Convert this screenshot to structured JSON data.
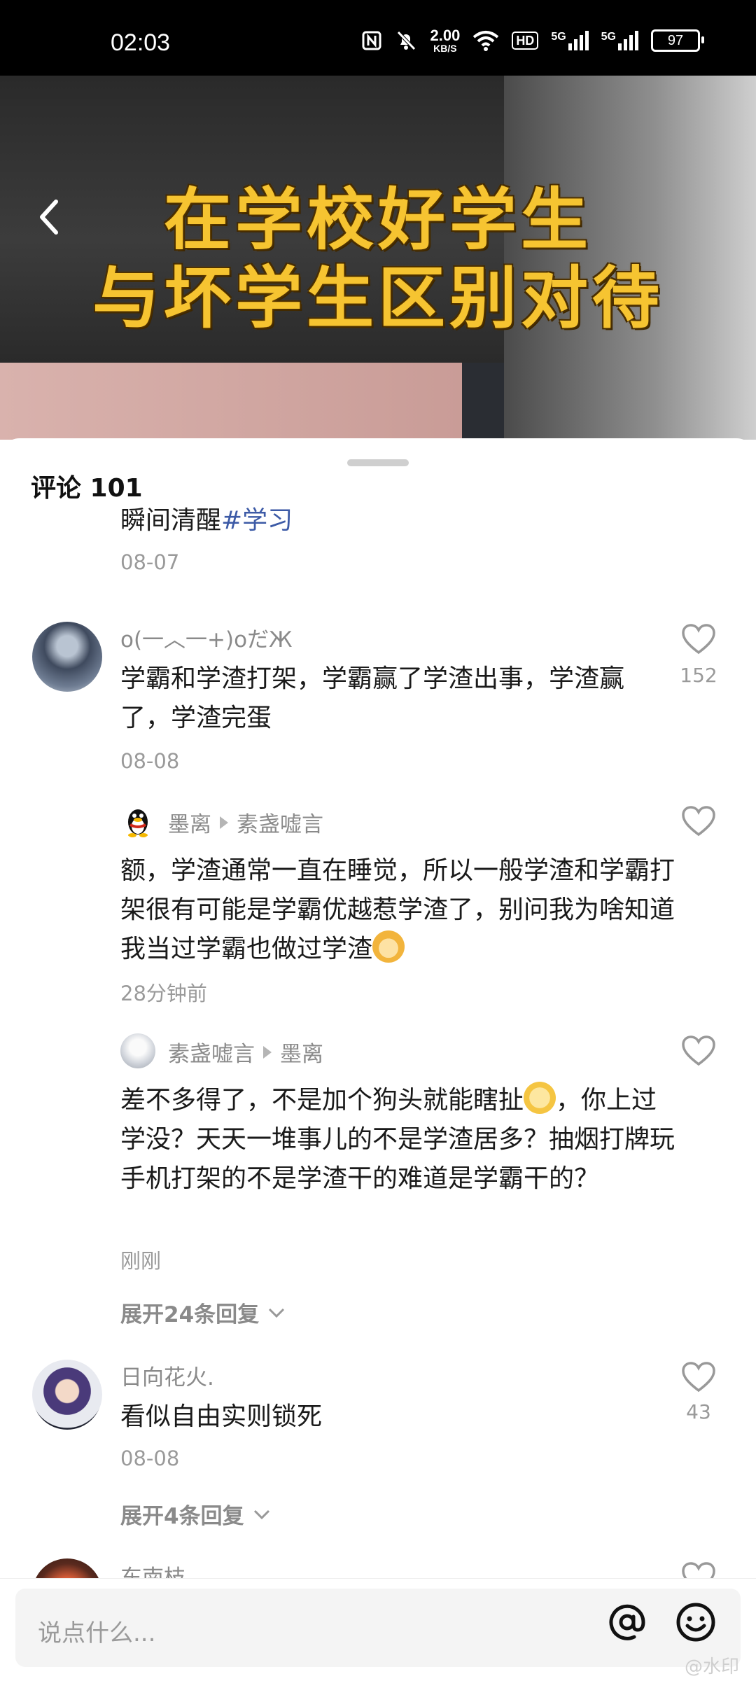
{
  "status_bar": {
    "time": "02:03",
    "net_speed": "2.00",
    "net_unit": "KB/S",
    "hd_label": "HD",
    "signal1": "5G",
    "signal2": "5G",
    "battery": "97"
  },
  "video": {
    "banner_line1": "在学校好学生",
    "banner_line2": "与坏学生区别对待"
  },
  "comments_sheet": {
    "title": "评论 101",
    "prev_text": "瞬间清醒",
    "prev_hashtag": "#学习",
    "prev_time": "08-07",
    "comments": [
      {
        "username": "o(一︿一+)oだЖ",
        "text": "学霸和学渣打架，学霸赢了学渣出事，学渣赢了，学渣完蛋",
        "time": "08-08",
        "likes": "152",
        "replies": [
          {
            "username": "墨离",
            "reply_to": "素盏嘘言",
            "text": "额，学渣通常一直在睡觉，所以一般学渣和学霸打架很有可能是学霸优越惹学渣了，别问我为啥知道我当过学霸也做过学渣",
            "time": "28分钟前"
          },
          {
            "username": "素盏嘘言",
            "reply_to": "墨离",
            "text_a": "差不多得了，不是加个狗头就能瞎扯",
            "text_b": "，你上过学没？天天一堆事儿的不是学渣居多？抽烟打牌玩手机打架的不是学渣干的难道是学霸干的？",
            "time": "刚刚"
          }
        ],
        "expand_label": "展开24条回复"
      },
      {
        "username": "日向花火.",
        "text": "看似自由实则锁死",
        "time": "08-08",
        "likes": "43",
        "expand_label": "展开4条回复"
      },
      {
        "username": "东南枝"
      }
    ]
  },
  "input": {
    "placeholder": "说点什么..."
  },
  "watermark": "@水印"
}
